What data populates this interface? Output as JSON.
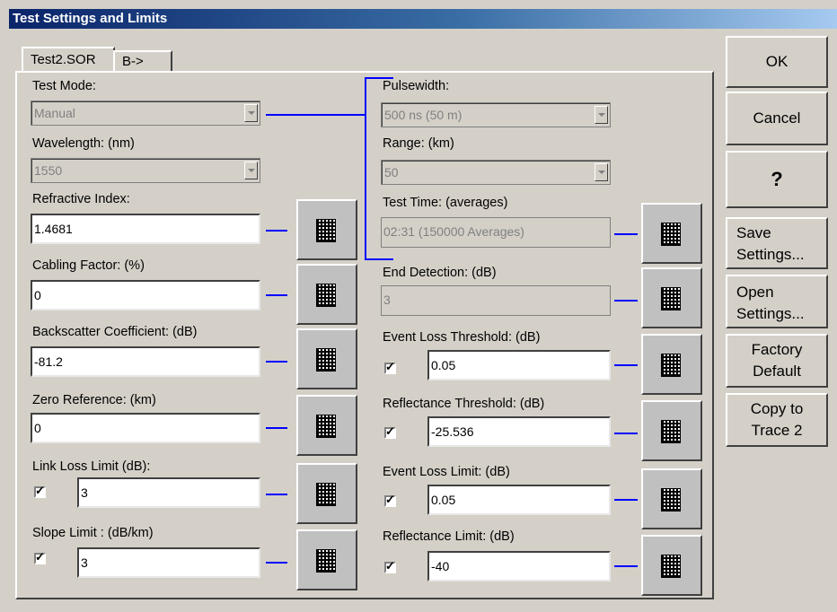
{
  "window": {
    "title": "Test Settings and Limits"
  },
  "tabs": [
    {
      "label": "Test2.SOR"
    },
    {
      "label": "B->"
    }
  ],
  "left": {
    "test_mode": {
      "label": "Test Mode:",
      "value": "Manual"
    },
    "wavelength": {
      "label": "Wavelength: (nm)",
      "value": "1550"
    },
    "refractive_index": {
      "label": "Refractive Index:",
      "value": "1.4681"
    },
    "cabling_factor": {
      "label": "Cabling Factor: (%)",
      "value": "0"
    },
    "backscatter": {
      "label": "Backscatter Coefficient: (dB)",
      "value": "-81.2"
    },
    "zero_reference": {
      "label": "Zero Reference: (km)",
      "value": "0"
    },
    "link_loss_limit": {
      "label": "Link Loss Limit (dB):",
      "value": "3",
      "checked": true
    },
    "slope_limit": {
      "label": "Slope Limit : (dB/km)",
      "value": "3",
      "checked": true
    }
  },
  "right": {
    "pulsewidth": {
      "label": "Pulsewidth:",
      "value": "500 ns (50 m)"
    },
    "range": {
      "label": "Range: (km)",
      "value": "50"
    },
    "test_time": {
      "label": "Test Time: (averages)",
      "value": "02:31 (150000 Averages)"
    },
    "end_detection": {
      "label": "End Detection: (dB)",
      "value": "3"
    },
    "event_loss_threshold": {
      "label": "Event Loss Threshold: (dB)",
      "value": "0.05",
      "checked": true
    },
    "reflectance_threshold": {
      "label": "Reflectance Threshold: (dB)",
      "value": "-25.536",
      "checked": true
    },
    "event_loss_limit": {
      "label": "Event Loss Limit: (dB)",
      "value": "0.05",
      "checked": true
    },
    "reflectance_limit": {
      "label": "Reflectance Limit: (dB)",
      "value": "-40",
      "checked": true
    }
  },
  "buttons": {
    "ok": "OK",
    "cancel": "Cancel",
    "help": "?",
    "save_1": "Save",
    "save_2": "Settings...",
    "open_1": "Open",
    "open_2": "Settings...",
    "factory_1": "Factory",
    "factory_2": "Default",
    "copy_1": "Copy to",
    "copy_2": "Trace 2"
  },
  "colors": {
    "connector": "#0000ff",
    "title_bar": "#0a246a"
  }
}
